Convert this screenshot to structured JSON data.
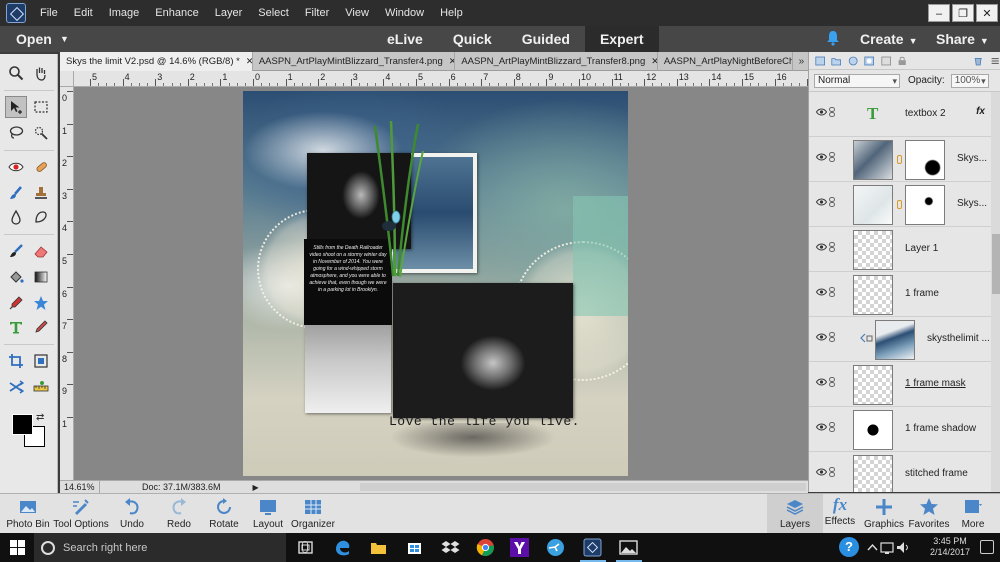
{
  "menubar": {
    "items": [
      "File",
      "Edit",
      "Image",
      "Enhance",
      "Layer",
      "Select",
      "Filter",
      "View",
      "Window",
      "Help"
    ]
  },
  "modebar": {
    "open_label": "Open",
    "modes": [
      "eLive",
      "Quick",
      "Guided",
      "Expert"
    ],
    "active_mode": "Expert",
    "create_label": "Create",
    "share_label": "Share"
  },
  "doc_tabs": [
    "Skys the limit V2.psd @ 14.6% (RGB/8) *",
    "AASPN_ArtPlayMintBlizzard_Transfer4.png",
    "AASPN_ArtPlayMintBlizzard_Transfer8.png",
    "AASPN_ArtPlayNightBeforeChris"
  ],
  "ruler": {
    "h_labels": [
      "5",
      "4",
      "3",
      "2",
      "1",
      "0",
      "1",
      "2",
      "3",
      "4",
      "5",
      "6",
      "7",
      "8",
      "9",
      "10",
      "11",
      "12",
      "13",
      "14",
      "15",
      "16",
      "17"
    ],
    "v_labels": [
      "0",
      "1",
      "2",
      "3",
      "4",
      "5",
      "6",
      "7",
      "8",
      "9",
      "1"
    ]
  },
  "artwork": {
    "journal_text": "Stills from the Death Railroader video shoot on a stormy winter day in November of 2014. You were going for a wind-whipped storm atmosphere, and you were able to achieve that, even though we were in a parking lot in Brooklyn.",
    "tagline": "Love the life you live."
  },
  "status": {
    "zoom": "14.61%",
    "doc": "Doc: 37.1M/383.6M"
  },
  "layers_panel": {
    "blend_mode": "Normal",
    "opacity_label": "Opacity:",
    "opacity_value": "100%",
    "layers": [
      {
        "name": "textbox 2",
        "type": "text",
        "fx": "fx"
      },
      {
        "name": "Skys...",
        "type": "masked"
      },
      {
        "name": "Skys...",
        "type": "masked"
      },
      {
        "name": "Layer 1",
        "type": "empty"
      },
      {
        "name": "1 frame",
        "type": "empty"
      },
      {
        "name": "skysthelimit ...",
        "type": "clipped"
      },
      {
        "name": "1 frame mask",
        "type": "empty"
      },
      {
        "name": "1 frame shadow",
        "type": "black"
      },
      {
        "name": "stitched frame",
        "type": "empty"
      }
    ]
  },
  "bottombar": {
    "left": [
      "Photo Bin",
      "Tool Options",
      "Undo",
      "Redo",
      "Rotate",
      "Layout",
      "Organizer"
    ],
    "right": [
      "Layers",
      "Effects",
      "Graphics",
      "Favorites",
      "More"
    ],
    "active": "Layers"
  },
  "taskbar": {
    "search_placeholder": "Search right here",
    "time": "3:45 PM",
    "date": "2/14/2017"
  },
  "colors": {
    "accent_blue": "#2a8fe0",
    "mode_active_bg": "#2b2b2b",
    "panel_bg": "#e6e6e6",
    "canvas_bg": "#878787"
  }
}
